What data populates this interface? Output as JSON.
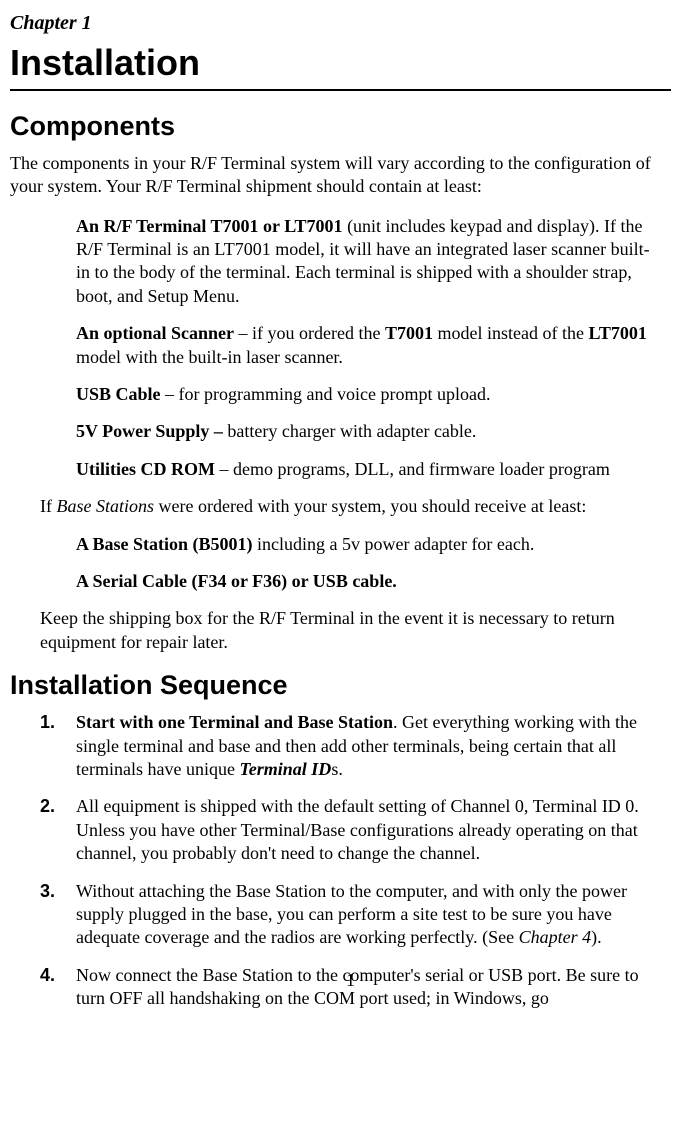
{
  "chapter_label": "Chapter 1",
  "chapter_title": "Installation",
  "section1": {
    "heading": "Components",
    "intro": "The components in your R/F Terminal system will vary according to the configuration of your system.  Your R/F Terminal shipment should contain at least:",
    "items": [
      {
        "lead": "An R/F Terminal T7001 or LT7001",
        "rest1": " (unit includes keypad and display).  If the R/F Terminal is an LT7001 model, it will have an integrated laser scanner built-in to the body of the terminal. Each terminal is shipped with a shoulder strap, boot, and Setup Menu."
      },
      {
        "lead": "An optional Scanner",
        "mid1": " – if you ordered the ",
        "bold2": "T7001",
        "mid2": " model instead of the ",
        "bold3": "LT7001",
        "rest1": " model with the built-in laser scanner."
      },
      {
        "lead": "USB Cable",
        "rest1": " – for programming and voice prompt upload."
      },
      {
        "lead": "5V Power Supply – ",
        "rest1": "battery charger with adapter cable."
      },
      {
        "lead": "Utilities CD ROM",
        "rest1": " – demo programs, DLL, and firmware loader program"
      }
    ],
    "para2_pre": "If ",
    "para2_ital": "Base Stations",
    "para2_post": " were ordered with your system, you should receive at least:",
    "bs_items": [
      {
        "lead": "A Base Station (B5001)",
        "rest1": " including a 5v power adapter for each."
      },
      {
        "lead": "A Serial Cable (F34 or F36) or USB cable.",
        "rest1": ""
      }
    ],
    "para3": "Keep the shipping box for the R/F Terminal in the event it is necessary to return equipment for repair later."
  },
  "section2": {
    "heading": "Installation Sequence",
    "steps": [
      {
        "num": "1.",
        "lead": "Start with one Terminal and Base Station",
        "mid1": ". Get everything working with the single terminal and base and then add other terminals, being certain that all terminals have unique ",
        "bi1": "Terminal ID",
        "rest1": "s."
      },
      {
        "num": "2.",
        "text": "All equipment is shipped with the default setting of Channel 0, Terminal ID 0.  Unless you have other Terminal/Base configurations already operating on that channel, you probably don't need to change the channel."
      },
      {
        "num": "3.",
        "pre": "Without attaching the Base Station to the computer, and with only the power supply plugged in the base, you can perform a site test to be sure you have adequate coverage and the radios are working perfectly. (See ",
        "ital": "Chapter 4",
        "post": ")."
      },
      {
        "num": "4.",
        "text": "Now connect the Base Station to the computer's serial or USB port. Be sure to turn OFF all handshaking on the COM port used; in Windows, go"
      }
    ]
  },
  "page_number": "1"
}
